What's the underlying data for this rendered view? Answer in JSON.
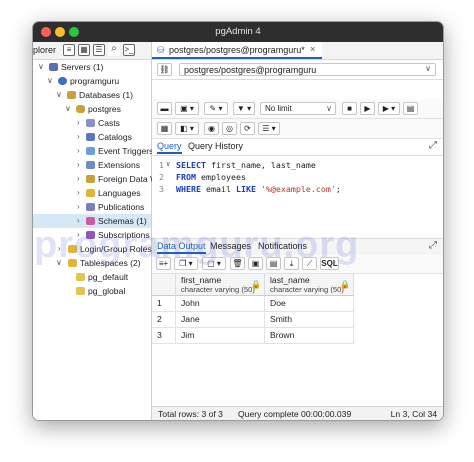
{
  "window": {
    "title": "pgAdmin 4"
  },
  "left_tabs": {
    "explorer_label": "plorer"
  },
  "tree": [
    {
      "label": "Servers (1)",
      "arrow": "∨",
      "icon": "server-group-icon",
      "color": "#5b6fb3"
    },
    {
      "label": "programguru",
      "arrow": "∨",
      "icon": "server-icon",
      "color": "#3a6fc4"
    },
    {
      "label": "Databases (1)",
      "arrow": "∨",
      "icon": "databases-icon",
      "color": "#c9a23a"
    },
    {
      "label": "postgres",
      "arrow": "∨",
      "icon": "database-icon",
      "color": "#c9a23a"
    },
    {
      "label": "Casts",
      "arrow": "›",
      "icon": "casts-icon",
      "color": "#8a8fd0"
    },
    {
      "label": "Catalogs",
      "arrow": "›",
      "icon": "catalogs-icon",
      "color": "#5a77c0"
    },
    {
      "label": "Event Triggers",
      "arrow": "›",
      "icon": "event-triggers-icon",
      "color": "#6aa0d8"
    },
    {
      "label": "Extensions",
      "arrow": "›",
      "icon": "extensions-icon",
      "color": "#6a8fc0"
    },
    {
      "label": "Foreign Data W",
      "arrow": "›",
      "icon": "foreign-data-icon",
      "color": "#c9a23a"
    },
    {
      "label": "Languages",
      "arrow": "›",
      "icon": "languages-icon",
      "color": "#e2b53a"
    },
    {
      "label": "Publications",
      "arrow": "›",
      "icon": "publications-icon",
      "color": "#7a7fc0"
    },
    {
      "label": "Schemas (1)",
      "arrow": "›",
      "icon": "schemas-icon",
      "color": "#d05aa0"
    },
    {
      "label": "Subscriptions",
      "arrow": "›",
      "icon": "subscriptions-icon",
      "color": "#8a5ac0"
    },
    {
      "label": "Login/Group Roles",
      "arrow": "›",
      "icon": "roles-icon",
      "color": "#e2b53a"
    },
    {
      "label": "Tablespaces (2)",
      "arrow": "∨",
      "icon": "tablespaces-icon",
      "color": "#e2b53a"
    },
    {
      "label": "pg_default",
      "arrow": "",
      "icon": "folder-icon",
      "color": "#e6c252"
    },
    {
      "label": "pg_global",
      "arrow": "",
      "icon": "folder-icon",
      "color": "#e6c252"
    }
  ],
  "query_tab": {
    "label": "postgres/postgres@programguru*"
  },
  "connection": {
    "label": "postgres/postgres@programguru"
  },
  "toolbar": {
    "limit_label": "No limit"
  },
  "query_tabs": {
    "query": "Query",
    "history": "Query History"
  },
  "editor": {
    "lines": [
      {
        "num": "1",
        "kw1": "SELECT",
        "rest1": " first_name, last_name",
        "kw2": "",
        "str": "",
        "end": ""
      },
      {
        "num": "2",
        "kw1": "FROM",
        "rest1": " employees",
        "kw2": "",
        "str": "",
        "end": ""
      },
      {
        "num": "3",
        "kw1": "WHERE",
        "rest1": " email ",
        "kw2": "LIKE",
        "str": " '%@example.com'",
        "end": ";"
      }
    ]
  },
  "output_tabs": {
    "data_output": "Data Output",
    "messages": "Messages",
    "notifications": "Notifications"
  },
  "result": {
    "sql_label": "SQL",
    "columns": [
      {
        "name": "first_name",
        "type": "character varying (50)"
      },
      {
        "name": "last_name",
        "type": "character varying (50)"
      }
    ],
    "rows": [
      {
        "n": "1",
        "first_name": "John",
        "last_name": "Doe"
      },
      {
        "n": "2",
        "first_name": "Jane",
        "last_name": "Smith"
      },
      {
        "n": "3",
        "first_name": "Jim",
        "last_name": "Brown"
      }
    ]
  },
  "status": {
    "total_rows": "Total rows: 3 of 3",
    "query_status": "Query complete 00:00:00.039",
    "position": "Ln 3, Col 34"
  },
  "watermark": "programguru.org",
  "colors": {
    "titlebar": "#2e2e2e",
    "selection": "#d6e7f6",
    "accent": "#1f5fbf",
    "close": "#ff5f57",
    "minimize": "#febc2e",
    "zoom": "#28c840"
  }
}
